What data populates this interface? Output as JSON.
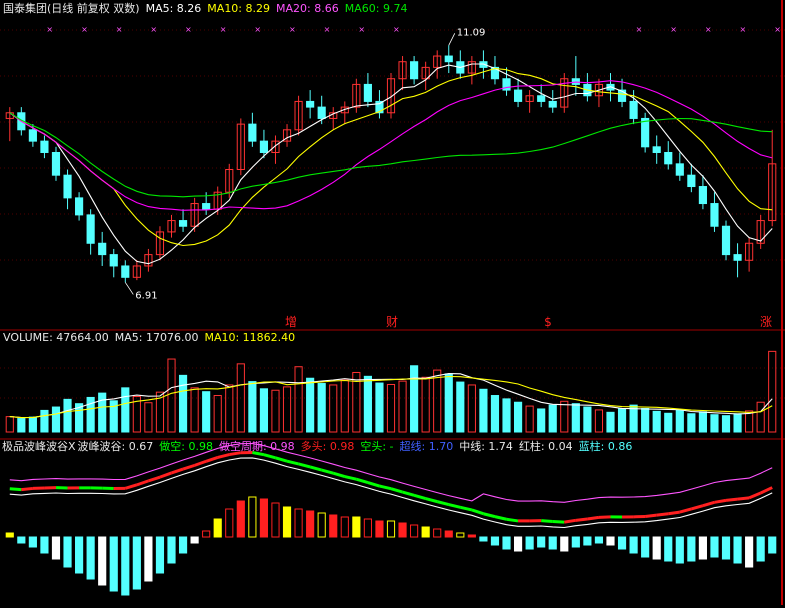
{
  "colors": {
    "bg": "#000000",
    "up": "#ff3232",
    "down": "#54ffff",
    "ma5": "#ffffff",
    "ma10": "#ffff00",
    "ma20": "#ff00ff",
    "ma60": "#00e600",
    "grid": "#a00000",
    "text": "#e8e8e8",
    "yellow": "#ffff00",
    "green": "#00ff00",
    "red": "#ff2020",
    "purple": "#ff55ff",
    "blue": "#4060ff"
  },
  "main_panel": {
    "title": "国泰集团(日线 前复权 双数)",
    "ma5": "MA5: 8.26",
    "ma10": "MA10: 8.29",
    "ma20": "MA20: 8.66",
    "ma60": "MA60: 9.74",
    "high_label": "11.09",
    "low_label": "6.91",
    "events": [
      "增",
      "财",
      "$",
      "涨"
    ]
  },
  "volume_panel": {
    "title": "VOLUME: 47664.00",
    "ma5": "MA5: 17076.00",
    "ma10": "MA10: 11862.40"
  },
  "indicator_panel": {
    "title": "极品波峰波谷X",
    "bfbg": "波峰波谷: 0.67",
    "zuokong": "做空: 0.98",
    "zuokong_zhouqi": "做空周期: 0.98",
    "duotou": "多头: 0.98",
    "kongtou": "空头: -",
    "chaoxian": "超线: 1.70",
    "zhongxian": "中线: 1.74",
    "hongzhu": "红柱: 0.04",
    "lanzhu": "蓝柱: 0.86"
  },
  "chart_data": {
    "type": "candlestick",
    "price_range": [
      6.6,
      11.5
    ],
    "ohlc": [
      [
        9.8,
        10.0,
        9.4,
        9.9
      ],
      [
        9.9,
        10.0,
        9.5,
        9.6
      ],
      [
        9.6,
        9.7,
        9.3,
        9.4
      ],
      [
        9.4,
        9.5,
        9.1,
        9.2
      ],
      [
        9.2,
        9.3,
        8.7,
        8.8
      ],
      [
        8.8,
        8.9,
        8.2,
        8.4
      ],
      [
        8.4,
        8.5,
        8.0,
        8.1
      ],
      [
        8.1,
        8.2,
        7.4,
        7.6
      ],
      [
        7.6,
        7.8,
        7.2,
        7.4
      ],
      [
        7.4,
        7.5,
        7.0,
        7.2
      ],
      [
        7.2,
        7.3,
        6.91,
        7.0
      ],
      [
        7.0,
        7.3,
        6.95,
        7.2
      ],
      [
        7.2,
        7.5,
        7.1,
        7.4
      ],
      [
        7.4,
        7.9,
        7.3,
        7.8
      ],
      [
        7.8,
        8.1,
        7.7,
        8.0
      ],
      [
        8.0,
        8.2,
        7.8,
        7.9
      ],
      [
        7.9,
        8.4,
        7.8,
        8.3
      ],
      [
        8.3,
        8.5,
        8.1,
        8.2
      ],
      [
        8.2,
        8.6,
        8.1,
        8.5
      ],
      [
        8.5,
        9.0,
        8.4,
        8.9
      ],
      [
        8.9,
        9.8,
        8.8,
        9.7
      ],
      [
        9.7,
        9.9,
        9.3,
        9.4
      ],
      [
        9.4,
        9.6,
        9.1,
        9.2
      ],
      [
        9.2,
        9.5,
        9.0,
        9.4
      ],
      [
        9.4,
        9.7,
        9.3,
        9.6
      ],
      [
        9.6,
        10.2,
        9.5,
        10.1
      ],
      [
        10.1,
        10.3,
        9.8,
        10.0
      ],
      [
        10.0,
        10.2,
        9.7,
        9.8
      ],
      [
        9.8,
        10.0,
        9.6,
        9.9
      ],
      [
        9.9,
        10.1,
        9.7,
        10.0
      ],
      [
        10.0,
        10.5,
        9.9,
        10.4
      ],
      [
        10.4,
        10.6,
        10.0,
        10.1
      ],
      [
        10.1,
        10.3,
        9.8,
        9.9
      ],
      [
        9.9,
        10.6,
        9.8,
        10.5
      ],
      [
        10.5,
        10.9,
        10.3,
        10.8
      ],
      [
        10.8,
        10.9,
        10.4,
        10.5
      ],
      [
        10.5,
        10.8,
        10.3,
        10.7
      ],
      [
        10.7,
        11.0,
        10.5,
        10.9
      ],
      [
        10.9,
        11.09,
        10.6,
        10.8
      ],
      [
        10.8,
        11.0,
        10.5,
        10.6
      ],
      [
        10.6,
        10.9,
        10.4,
        10.8
      ],
      [
        10.8,
        11.0,
        10.5,
        10.7
      ],
      [
        10.7,
        10.9,
        10.4,
        10.5
      ],
      [
        10.5,
        10.7,
        10.2,
        10.3
      ],
      [
        10.3,
        10.5,
        10.0,
        10.1
      ],
      [
        10.1,
        10.3,
        9.9,
        10.2
      ],
      [
        10.2,
        10.4,
        10.0,
        10.1
      ],
      [
        10.1,
        10.3,
        9.9,
        10.0
      ],
      [
        10.0,
        10.6,
        9.9,
        10.5
      ],
      [
        10.5,
        10.9,
        10.2,
        10.4
      ],
      [
        10.4,
        10.6,
        10.1,
        10.2
      ],
      [
        10.2,
        10.5,
        10.0,
        10.4
      ],
      [
        10.4,
        10.6,
        10.1,
        10.3
      ],
      [
        10.3,
        10.5,
        10.0,
        10.1
      ],
      [
        10.1,
        10.3,
        9.7,
        9.8
      ],
      [
        9.8,
        9.9,
        9.2,
        9.3
      ],
      [
        9.3,
        9.5,
        9.0,
        9.2
      ],
      [
        9.2,
        9.4,
        8.9,
        9.0
      ],
      [
        9.0,
        9.2,
        8.7,
        8.8
      ],
      [
        8.8,
        9.0,
        8.5,
        8.6
      ],
      [
        8.6,
        8.8,
        8.2,
        8.3
      ],
      [
        8.3,
        8.5,
        7.8,
        7.9
      ],
      [
        7.9,
        8.0,
        7.3,
        7.4
      ],
      [
        7.4,
        7.6,
        7.0,
        7.3
      ],
      [
        7.3,
        7.7,
        7.1,
        7.6
      ],
      [
        7.6,
        8.1,
        7.5,
        8.0
      ],
      [
        8.0,
        9.6,
        7.9,
        9.0
      ]
    ],
    "volume": [
      3200,
      2800,
      3100,
      4500,
      5200,
      6800,
      5900,
      7200,
      8100,
      6500,
      9200,
      7400,
      6100,
      8300,
      15200,
      11800,
      9200,
      8400,
      7600,
      9800,
      14200,
      10500,
      9000,
      8700,
      9400,
      13600,
      11200,
      10100,
      9800,
      10800,
      12400,
      11600,
      10200,
      9900,
      10600,
      13800,
      11400,
      12900,
      12100,
      10400,
      9800,
      8900,
      7600,
      6900,
      6200,
      5400,
      4800,
      5600,
      6400,
      5900,
      5200,
      4600,
      4100,
      4800,
      5600,
      4900,
      4300,
      3900,
      4500,
      3800,
      4200,
      3600,
      3400,
      3800,
      4400,
      6200,
      16800
    ],
    "indicator_bars": [
      0.2,
      -0.3,
      -0.5,
      -0.8,
      -1.1,
      -1.5,
      -1.8,
      -2.1,
      -2.4,
      -2.7,
      -2.9,
      -2.6,
      -2.2,
      -1.8,
      -1.3,
      -0.8,
      -0.3,
      0.3,
      0.9,
      1.4,
      1.8,
      2.0,
      1.9,
      1.7,
      1.5,
      1.4,
      1.3,
      1.2,
      1.1,
      1.0,
      1.0,
      0.9,
      0.8,
      0.8,
      0.7,
      0.6,
      0.5,
      0.4,
      0.3,
      0.2,
      0.1,
      -0.2,
      -0.4,
      -0.6,
      -0.7,
      -0.6,
      -0.5,
      -0.6,
      -0.7,
      -0.5,
      -0.4,
      -0.3,
      -0.4,
      -0.6,
      -0.8,
      -1.0,
      -1.1,
      -1.2,
      -1.3,
      -1.2,
      -1.1,
      -1.0,
      -1.1,
      -1.3,
      -1.5,
      -1.2,
      -0.8
    ]
  }
}
